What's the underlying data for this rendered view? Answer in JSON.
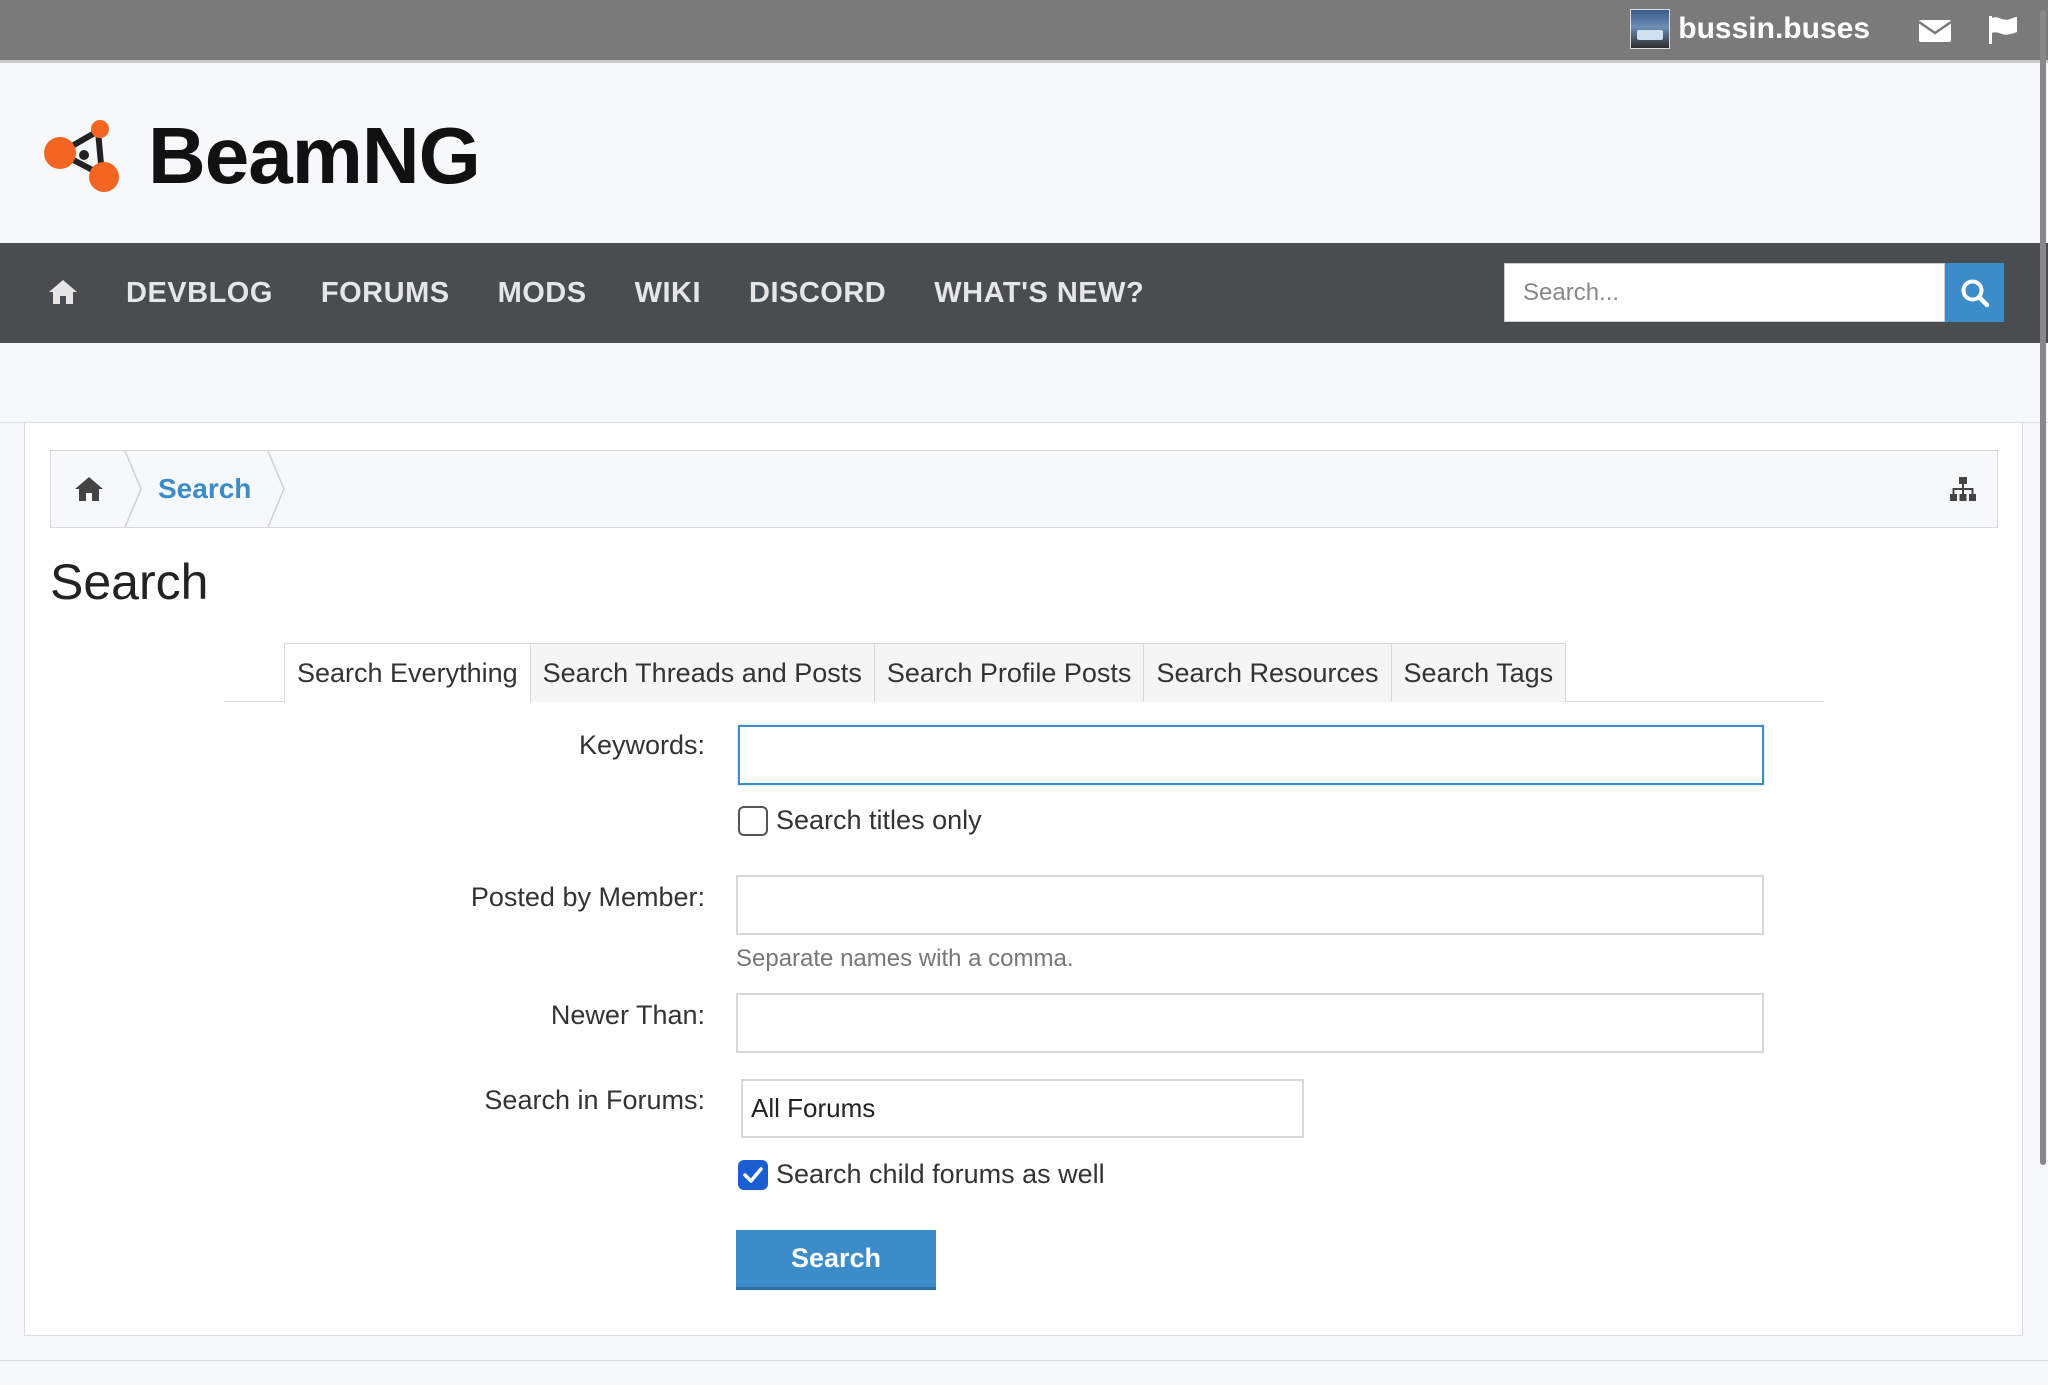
{
  "topbar": {
    "username": "bussin.buses",
    "avatar_text": "BSIN.BUS",
    "icons": [
      "envelope-icon",
      "flag-icon"
    ]
  },
  "header": {
    "logo_text": "BeamNG",
    "logo_icon": "beamng-node-logo"
  },
  "nav": {
    "home_icon": "home-icon",
    "items": [
      "DEVBLOG",
      "FORUMS",
      "MODS",
      "WIKI",
      "DISCORD",
      "WHAT'S NEW?"
    ],
    "search_placeholder": "Search...",
    "search_icon": "search-icon"
  },
  "breadcrumb": {
    "home_icon": "home-icon",
    "current": "Search",
    "right_icon": "sitemap-icon"
  },
  "page": {
    "title": "Search"
  },
  "tabs": [
    {
      "label": "Search Everything",
      "active": true
    },
    {
      "label": "Search Threads and Posts",
      "active": false
    },
    {
      "label": "Search Profile Posts",
      "active": false
    },
    {
      "label": "Search Resources",
      "active": false
    },
    {
      "label": "Search Tags",
      "active": false
    }
  ],
  "form": {
    "keywords_label": "Keywords:",
    "keywords_value": "",
    "titles_only_label": "Search titles only",
    "titles_only_checked": false,
    "member_label": "Posted by Member:",
    "member_value": "",
    "member_hint": "Separate names with a comma.",
    "newer_label": "Newer Than:",
    "newer_value": "",
    "forums_label": "Search in Forums:",
    "forums_value": "All Forums",
    "child_forums_label": "Search child forums as well",
    "child_forums_checked": true,
    "submit_label": "Search"
  },
  "colors": {
    "accent": "#3b8cc9",
    "nav_bg": "#4a4d50",
    "topbar_bg": "#7a7a7a",
    "logo_orange": "#f26522"
  }
}
